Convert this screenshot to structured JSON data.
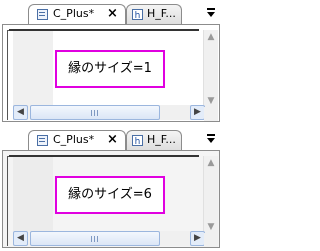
{
  "panels": [
    {
      "tabs": [
        {
          "label": "C_Plus*",
          "close": "×"
        },
        {
          "label": "H_F..."
        }
      ],
      "menu_arrow": "▼",
      "content": "縁のサイズ=1",
      "accent_color": "#e000e0"
    },
    {
      "tabs": [
        {
          "label": "C_Plus*",
          "close": "×"
        },
        {
          "label": "H_F..."
        }
      ],
      "menu_arrow": "▼",
      "content": "縁のサイズ=6",
      "accent_color": "#e000e0"
    }
  ],
  "icons": {
    "file_icon": "file-icon",
    "header_icon": "h-file-icon",
    "scroll_left": "◀",
    "scroll_right": "▶",
    "scroll_up": "▲",
    "scroll_down": "▼"
  }
}
